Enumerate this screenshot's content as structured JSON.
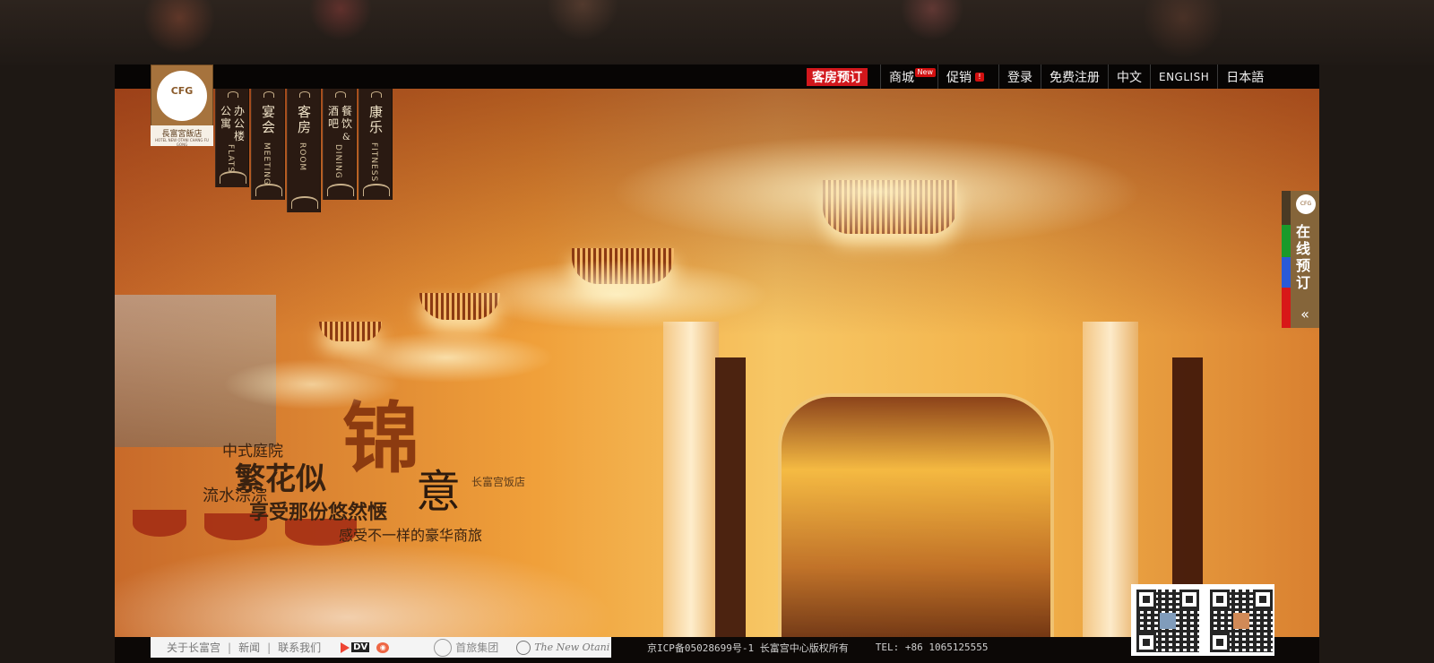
{
  "brand": {
    "logo_name": "長富宮飯店",
    "logo_sub": "HOTEL NEW OTANI CHANG FU GONG",
    "emblem": "CFG",
    "colors": {
      "logo_bg": "#a6733d",
      "nav_dark": "#2a1a12",
      "booking_red": "#d2171c",
      "side_tab": "#85653a"
    }
  },
  "top_nav": {
    "booking": "客房预订",
    "items": [
      {
        "label": "商城",
        "badge": "New"
      },
      {
        "label": "促销",
        "badge": "!"
      },
      {
        "label": "登录"
      },
      {
        "label": "免费注册"
      },
      {
        "label": "中文"
      },
      {
        "label": "ENGLISH"
      },
      {
        "label": "日本語"
      }
    ]
  },
  "vertical_nav": [
    {
      "cn_a": "办公楼",
      "cn_b": "公寓",
      "en": "FLATS"
    },
    {
      "cn": "宴会",
      "en": "MEETING"
    },
    {
      "cn": "客房",
      "en": "ROOM"
    },
    {
      "cn_a": "餐饮",
      "cn_b": "酒吧",
      "mid": "&",
      "en": "DINING"
    },
    {
      "cn": "康乐",
      "en": "FITNESS"
    }
  ],
  "hero": {
    "line1": "中式庭院",
    "line2": "繁花似",
    "big_char": "锦",
    "line3": "流水淙淙",
    "yi": "意",
    "line4": "享受那份悠然惬",
    "line5": "感受不一样的豪华商旅",
    "stamp": "长富宫饭店"
  },
  "side_booking": {
    "label": "在线预订",
    "collapse": "«",
    "logo_text": "CFG"
  },
  "footer": {
    "links": [
      "关于长富宫",
      "新闻",
      "联系我们"
    ],
    "dv_label": "DV",
    "weibo_icon": "weibo-icon",
    "group_label": "首旅集团",
    "otani_label": "The New Otani",
    "icp": "京ICP备05028699号-1 长富宫中心版权所有",
    "tel": "TEL: +86 1065125555"
  }
}
